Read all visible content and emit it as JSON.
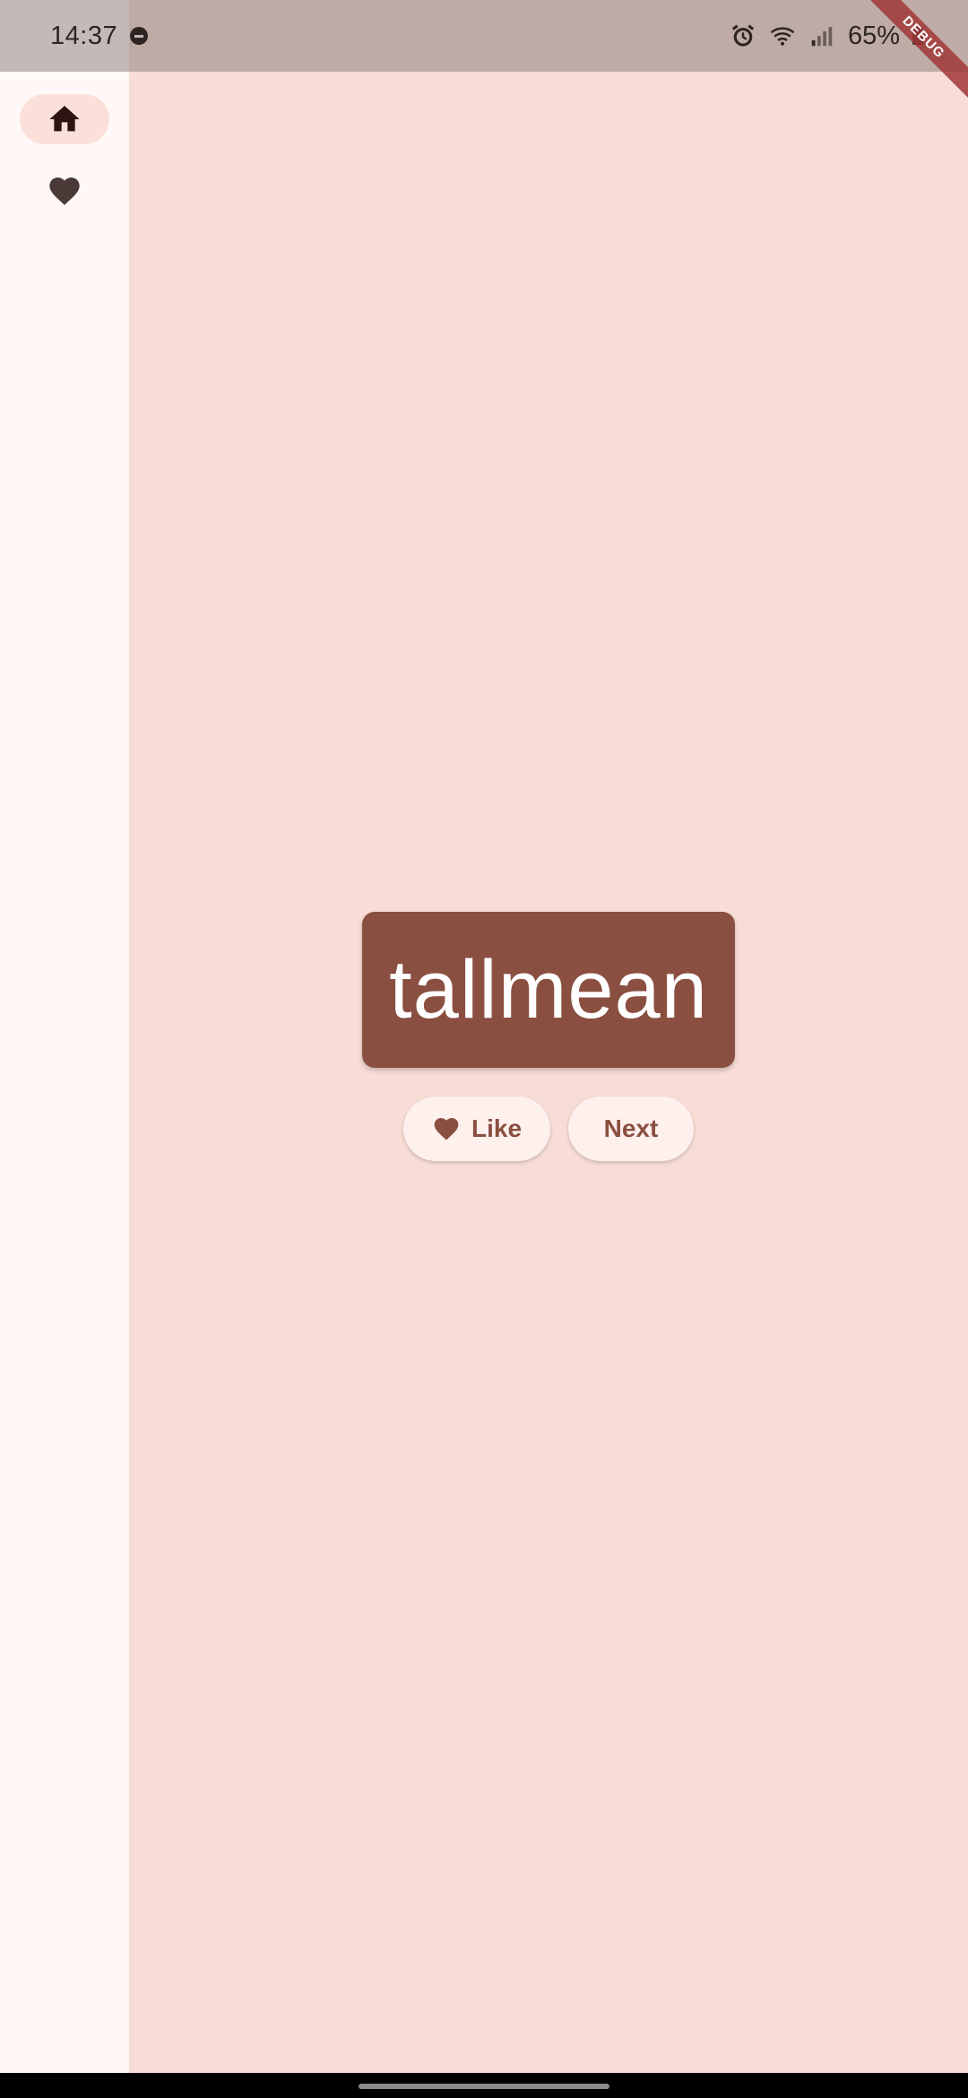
{
  "status_bar": {
    "time": "14:37",
    "battery": "65%",
    "icons": [
      "dnd-icon",
      "alarm-icon",
      "wifi-icon",
      "signal-icon",
      "battery-icon"
    ]
  },
  "debug_banner": {
    "label": "DEBUG"
  },
  "nav_rail": {
    "destinations": [
      {
        "icon": "home-icon",
        "selected": true
      },
      {
        "icon": "favorite-icon",
        "selected": false
      }
    ]
  },
  "main": {
    "word": "tallmean",
    "like_label": "Like",
    "next_label": "Next"
  },
  "colors": {
    "background": "#f8ddd6",
    "rail": "#fff8f6",
    "card": "#8a4f40",
    "button": "#fdf0ed",
    "button_text": "#8a4f40"
  }
}
